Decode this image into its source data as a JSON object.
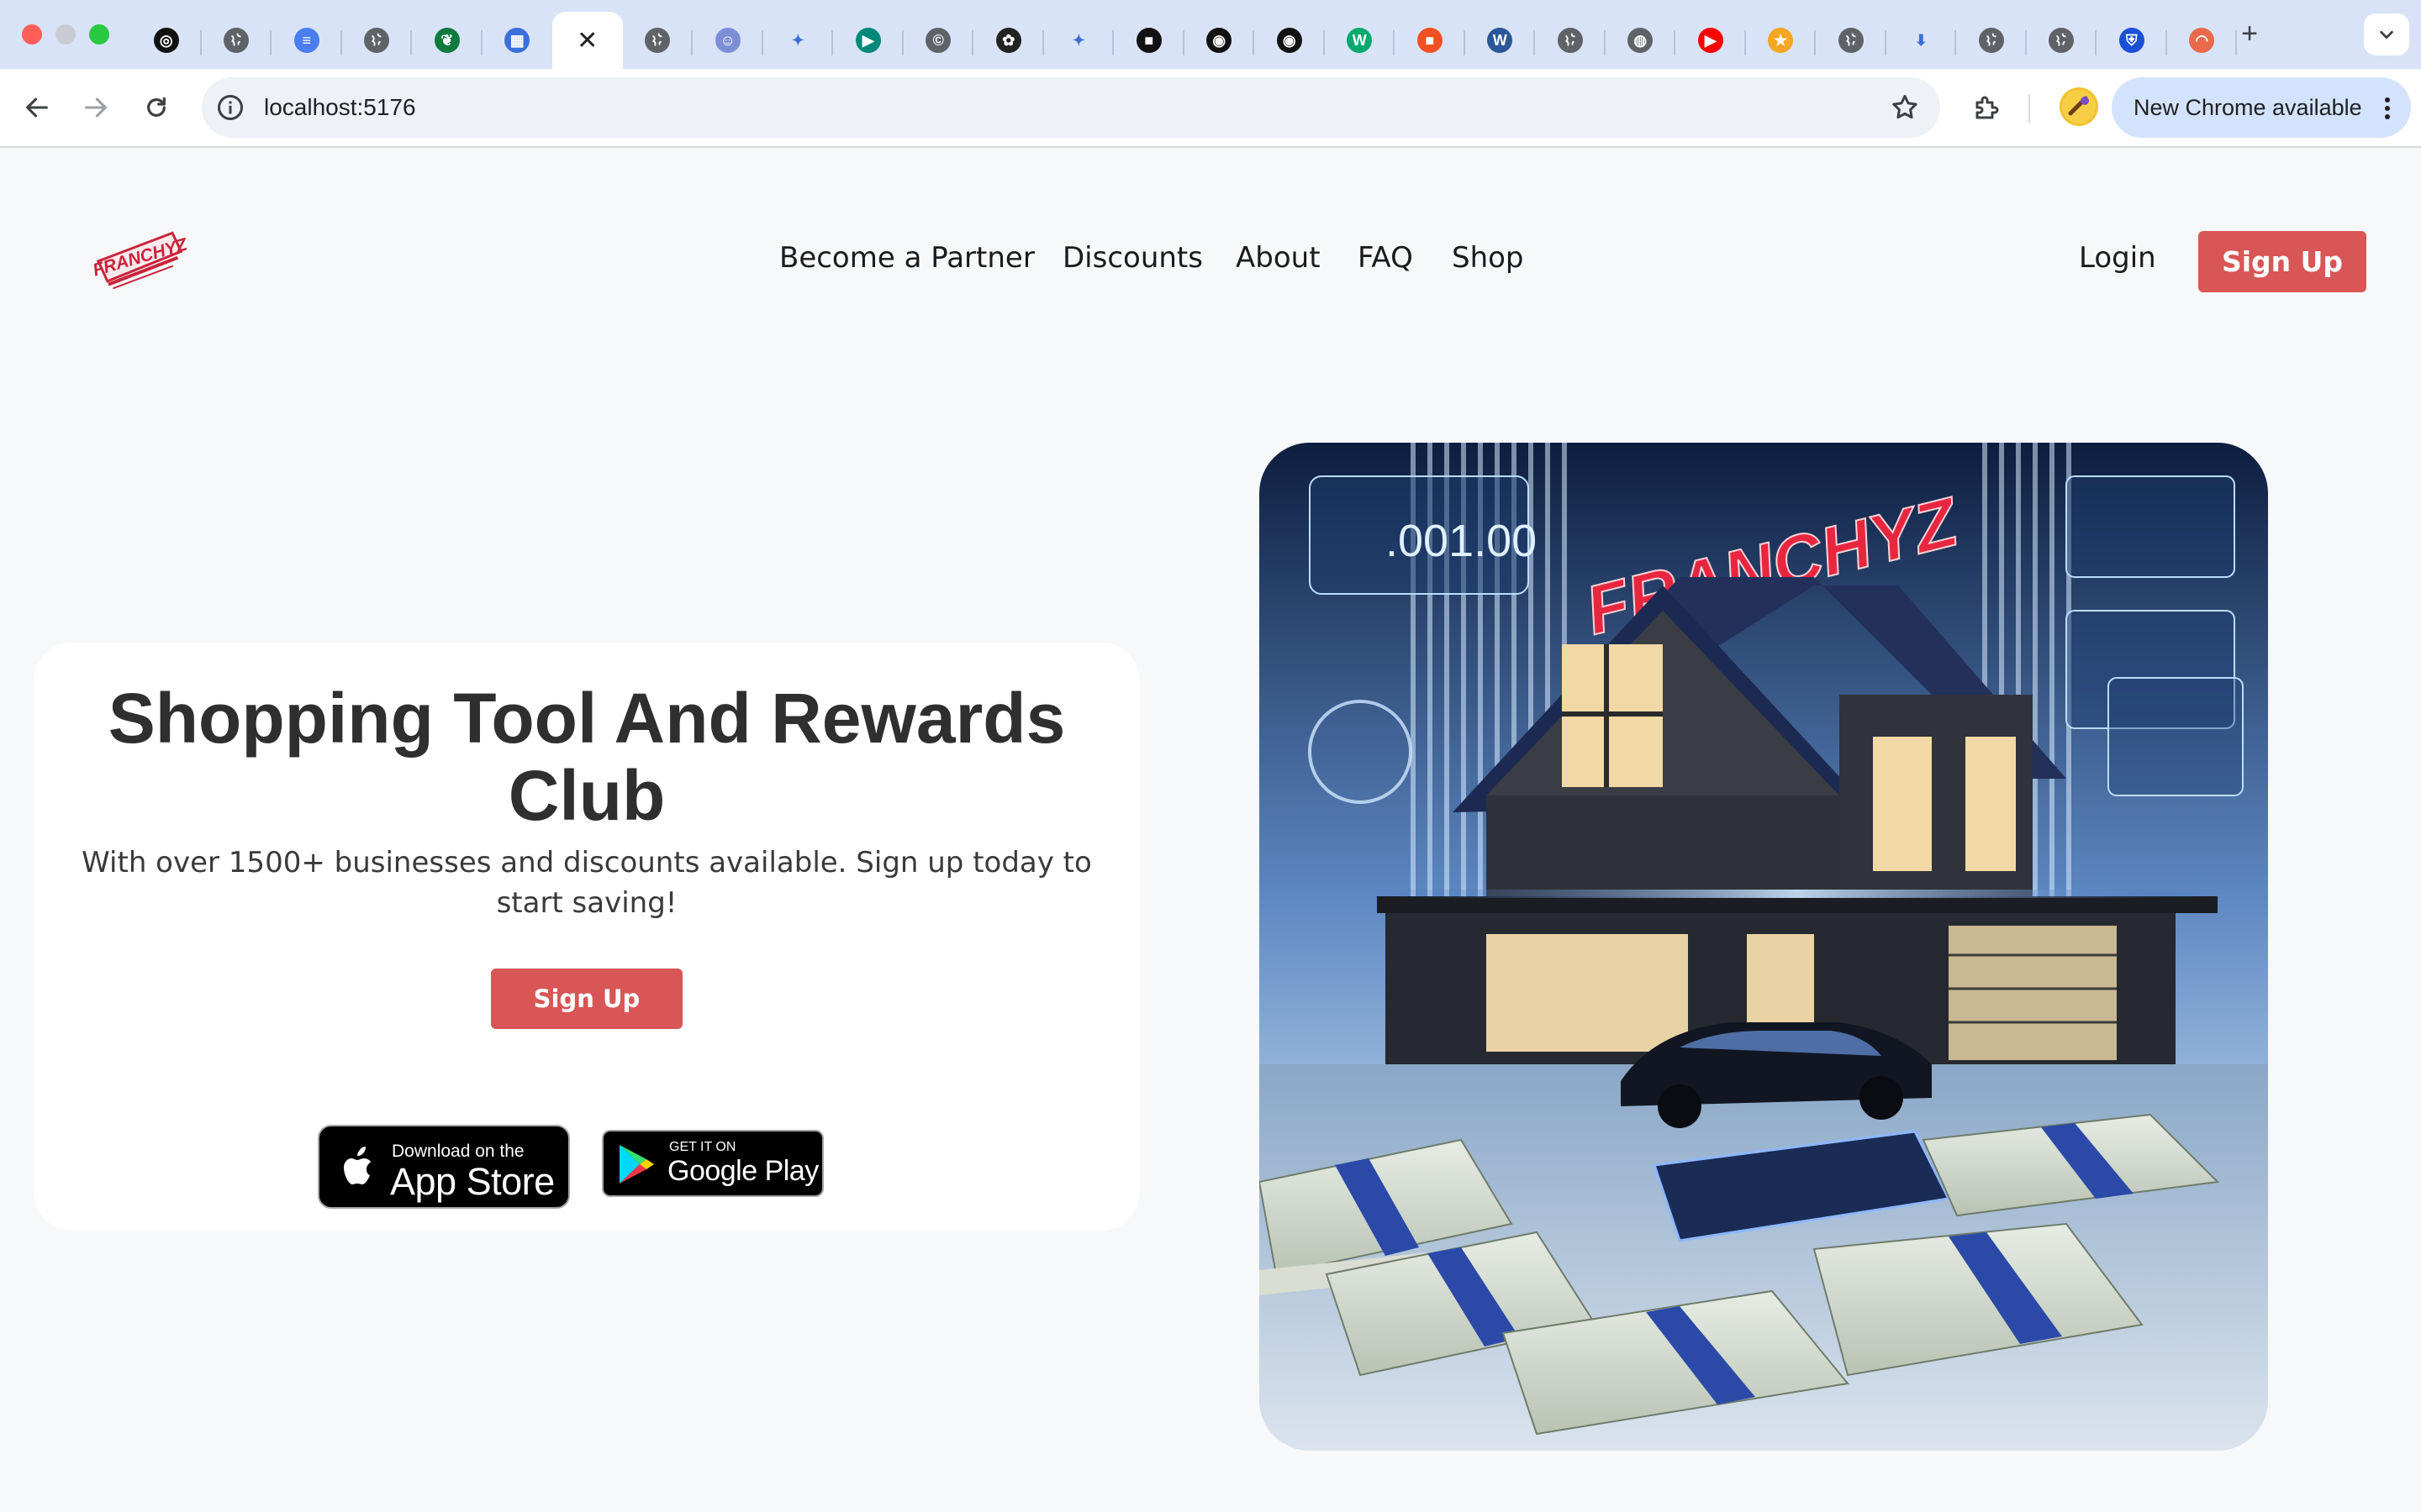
{
  "browser": {
    "tabs": [
      {
        "icon": "chatgpt-icon"
      },
      {
        "icon": "globe-icon"
      },
      {
        "icon": "google-docs-icon"
      },
      {
        "icon": "globe-icon"
      },
      {
        "icon": "leaf-icon"
      },
      {
        "icon": "image-icon"
      },
      {
        "icon": "close-icon",
        "close_glyph": "✕",
        "active": true
      },
      {
        "icon": "globe-icon"
      },
      {
        "icon": "robot-icon"
      },
      {
        "icon": "sparkle-icon"
      },
      {
        "icon": "google-meet-icon"
      },
      {
        "icon": "copyright-icon"
      },
      {
        "icon": "copilot-icon"
      },
      {
        "icon": "sparkle-icon"
      },
      {
        "icon": "black-square-icon"
      },
      {
        "icon": "github-icon"
      },
      {
        "icon": "github-icon"
      },
      {
        "icon": "w3schools-icon"
      },
      {
        "icon": "microsoft-icon"
      },
      {
        "icon": "word-icon"
      },
      {
        "icon": "globe-icon"
      },
      {
        "icon": "chrome-icon"
      },
      {
        "icon": "youtube-icon"
      },
      {
        "icon": "star-icon"
      },
      {
        "icon": "globe-icon"
      },
      {
        "icon": "download-icon"
      },
      {
        "icon": "globe-icon"
      },
      {
        "icon": "globe-icon"
      },
      {
        "icon": "shield-icon"
      },
      {
        "icon": "rainbow-icon"
      }
    ],
    "new_tab_glyph": "+",
    "address": "localhost:5176",
    "update_pill": "New Chrome available",
    "colors": {
      "tabstrip": "#d8e3f8",
      "pill": "#d3e3fd"
    }
  },
  "site": {
    "logo_text": "FRANCHYZ",
    "nav": [
      "Become a Partner",
      "Discounts",
      "About",
      "FAQ",
      "Shop"
    ],
    "login_label": "Login",
    "signup_label": "Sign Up",
    "accent_color": "#d95656"
  },
  "hero": {
    "title": "Shopping Tool And Rewards Club",
    "subtitle": "With over 1500+ businesses and discounts available. Sign up today to start saving!",
    "cta_label": "Sign Up",
    "app_store_small": "Download on the",
    "app_store_big": "App Store",
    "google_play_small": "GET IT ON",
    "google_play_big": "Google Play",
    "image_counter": ".001.00",
    "image_logo_text": "FRANCHYZ"
  }
}
